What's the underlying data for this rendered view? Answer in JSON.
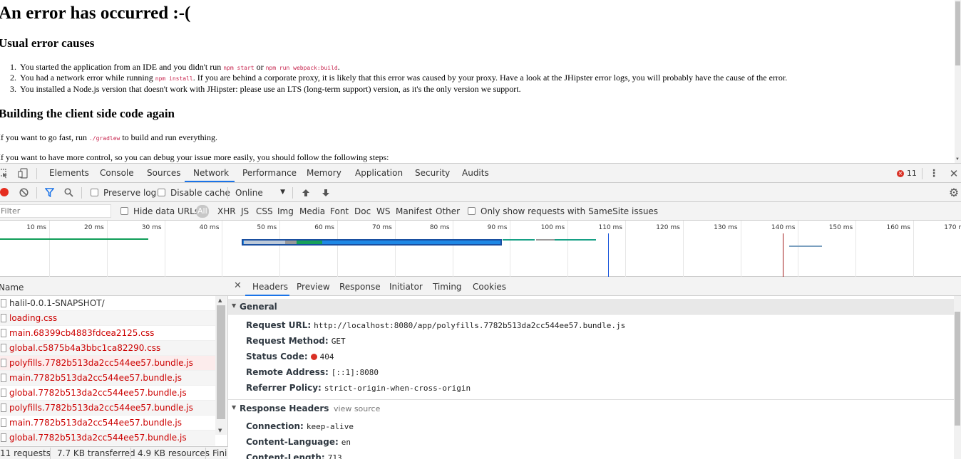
{
  "page": {
    "title": "An error has occurred :-(",
    "causes_heading": "Usual error causes",
    "causes": [
      {
        "num": "1.",
        "before": "You started the application from an IDE and you didn't run ",
        "code1": "npm start",
        "mid": " or ",
        "code2": "npm run webpack:build",
        "after": "."
      },
      {
        "num": "2.",
        "before": "You had a network error while running ",
        "code1": "npm install",
        "after": ". If you are behind a corporate proxy, it is likely that this error was caused by your proxy. Have a look at the JHipster error logs, you will probably have the cause of the error."
      },
      {
        "num": "3.",
        "text": "You installed a Node.js version that doesn't work with JHipster: please use an LTS (long-term support) version, as it's the only version we support."
      }
    ],
    "build_heading": "Building the client side code again",
    "fast_before": "If you want to go fast, run ",
    "fast_code": "./gradlew",
    "fast_after": " to build and run everything.",
    "control_text": "If you want to have more control, so you can debug your issue more easily, you should follow the following steps:"
  },
  "devtools": {
    "tabs": [
      "Elements",
      "Console",
      "Sources",
      "Network",
      "Performance",
      "Memory",
      "Application",
      "Security",
      "Audits"
    ],
    "active_tab": "Network",
    "error_count": "11",
    "toolbar": {
      "preserve_log": "Preserve log",
      "disable_cache": "Disable cache",
      "throttle": "Online"
    },
    "filter": {
      "placeholder": "Filter",
      "hide_data_urls": "Hide data URLs",
      "types": [
        "All",
        "XHR",
        "JS",
        "CSS",
        "Img",
        "Media",
        "Font",
        "Doc",
        "WS",
        "Manifest",
        "Other"
      ],
      "samesite": "Only show requests with SameSite issues"
    },
    "timeline_ticks": [
      "10 ms",
      "20 ms",
      "30 ms",
      "40 ms",
      "50 ms",
      "60 ms",
      "70 ms",
      "80 ms",
      "90 ms",
      "100 ms",
      "110 ms",
      "120 ms",
      "130 ms",
      "140 ms",
      "150 ms",
      "160 ms",
      "170 ms"
    ],
    "list": {
      "name_header": "Name",
      "requests": [
        {
          "name": "halil-0.0.1-SNAPSHOT/",
          "error": false
        },
        {
          "name": "loading.css",
          "error": true
        },
        {
          "name": "main.68399cb4883fdcea2125.css",
          "error": true
        },
        {
          "name": "global.c5875b4a3bbc1ca82290.css",
          "error": true
        },
        {
          "name": "polyfills.7782b513da2cc544ee57.bundle.js",
          "error": true
        },
        {
          "name": "main.7782b513da2cc544ee57.bundle.js",
          "error": true
        },
        {
          "name": "global.7782b513da2cc544ee57.bundle.js",
          "error": true
        },
        {
          "name": "polyfills.7782b513da2cc544ee57.bundle.js",
          "error": true
        },
        {
          "name": "main.7782b513da2cc544ee57.bundle.js",
          "error": true
        },
        {
          "name": "global.7782b513da2cc544ee57.bundle.js",
          "error": true
        }
      ],
      "status": {
        "requests": "11 requests",
        "transferred": "7.7 KB transferred",
        "resources": "4.9 KB resources",
        "finish": "Fini"
      }
    },
    "details": {
      "tabs": [
        "Headers",
        "Preview",
        "Response",
        "Initiator",
        "Timing",
        "Cookies"
      ],
      "active_tab": "Headers",
      "general_title": "General",
      "general": [
        {
          "key": "Request URL:",
          "value": "http://localhost:8080/app/polyfills.7782b513da2cc544ee57.bundle.js"
        },
        {
          "key": "Request Method:",
          "value": "GET"
        },
        {
          "key": "Status Code:",
          "value": "404"
        },
        {
          "key": "Remote Address:",
          "value": "[::1]:8080"
        },
        {
          "key": "Referrer Policy:",
          "value": "strict-origin-when-cross-origin"
        }
      ],
      "response_title": "Response Headers",
      "view_source": "view source",
      "response": [
        {
          "key": "Connection:",
          "value": "keep-alive"
        },
        {
          "key": "Content-Language:",
          "value": "en"
        },
        {
          "key": "Content-Length:",
          "value": "713"
        }
      ]
    }
  }
}
